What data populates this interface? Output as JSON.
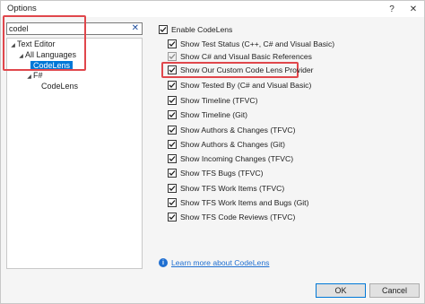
{
  "window": {
    "title": "Options",
    "help_label": "?",
    "close_label": "✕"
  },
  "search": {
    "value": "codel",
    "clear_label": "✕"
  },
  "tree": {
    "items": [
      {
        "label": "Text Editor",
        "expanded": true
      },
      {
        "label": "All Languages",
        "expanded": true
      },
      {
        "label": "CodeLens",
        "selected": true
      },
      {
        "label": "F#",
        "expanded": true
      },
      {
        "label": "CodeLens",
        "selected": false
      }
    ]
  },
  "settings": {
    "enable": {
      "label": "Enable CodeLens",
      "checked": true
    },
    "items": [
      {
        "label": "Show Test Status (C++, C# and Visual Basic)",
        "checked": true,
        "disabled": false
      },
      {
        "label": "Show C# and Visual Basic References",
        "checked": true,
        "disabled": true
      },
      {
        "label": "Show Our Custom Code Lens Provider",
        "checked": true,
        "disabled": false
      },
      {
        "label": "Show Tested By (C# and Visual Basic)",
        "checked": true,
        "disabled": false
      },
      {
        "label": "Show Timeline (TFVC)",
        "checked": true,
        "disabled": false
      },
      {
        "label": "Show Timeline (Git)",
        "checked": true,
        "disabled": false
      },
      {
        "label": "Show Authors & Changes (TFVC)",
        "checked": true,
        "disabled": false
      },
      {
        "label": "Show Authors & Changes (Git)",
        "checked": true,
        "disabled": false
      },
      {
        "label": "Show Incoming Changes (TFVC)",
        "checked": true,
        "disabled": false
      },
      {
        "label": "Show TFS Bugs (TFVC)",
        "checked": true,
        "disabled": false
      },
      {
        "label": "Show TFS Work Items (TFVC)",
        "checked": true,
        "disabled": false
      },
      {
        "label": "Show TFS Work Items and Bugs (Git)",
        "checked": true,
        "disabled": false
      },
      {
        "label": "Show TFS Code Reviews (TFVC)",
        "checked": true,
        "disabled": false
      }
    ]
  },
  "learn_more": {
    "icon": "info-icon",
    "label": "Learn more about CodeLens"
  },
  "buttons": {
    "ok": "OK",
    "cancel": "Cancel"
  },
  "colors": {
    "accent": "#0078d7",
    "link": "#1f6fd1",
    "annotation": "#e0474c"
  }
}
